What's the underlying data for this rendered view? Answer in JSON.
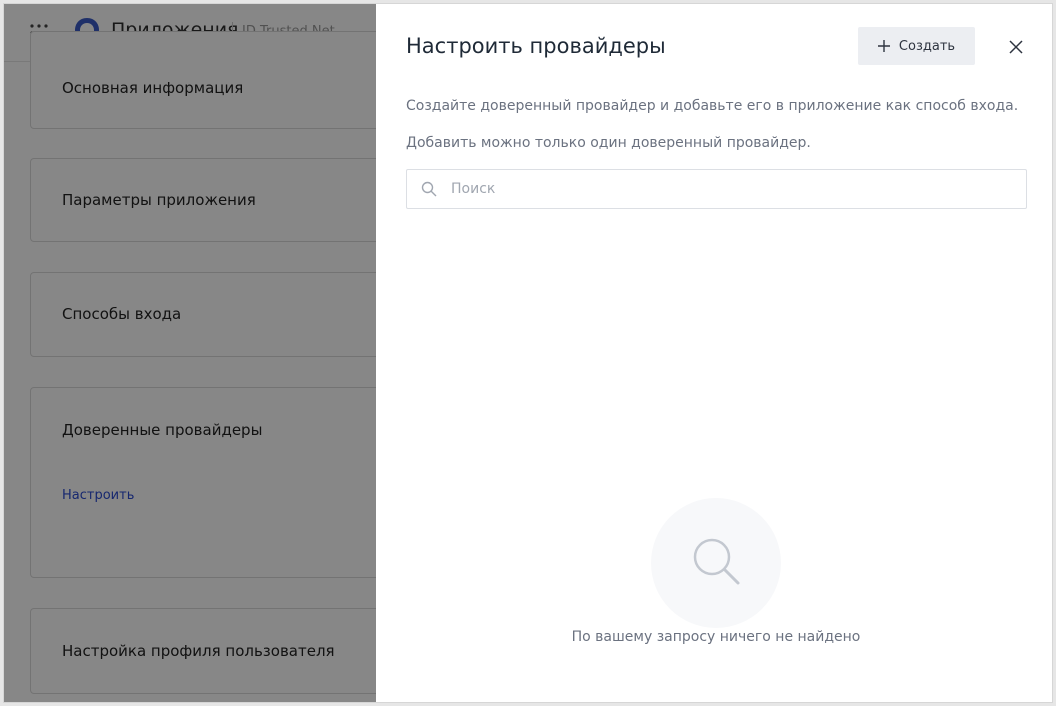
{
  "app": {
    "title": "Приложения",
    "subtitle": "ID.Trusted.Net",
    "cards": [
      {
        "title": "Основная информация"
      },
      {
        "title": "Параметры приложения"
      },
      {
        "title": "Способы входа"
      },
      {
        "title": "Доверенные провайдеры",
        "link": "Настроить"
      },
      {
        "title": "Настройка профиля пользователя"
      }
    ]
  },
  "drawer": {
    "title": "Настроить провайдеры",
    "create_label": "Создать",
    "description_1": "Создайте доверенный провайдер и добавьте его в приложение как способ входа.",
    "description_2": "Добавить можно только один доверенный провайдер.",
    "search": {
      "placeholder": "Поиск",
      "value": ""
    },
    "empty_text": "По вашему запросу ничего не найдено"
  },
  "icons": {
    "apps_grid": "grid-icon",
    "logo": "logo-icon",
    "create": "plus-icon",
    "close": "close-icon",
    "search": "search-icon",
    "empty_state": "magnifier-icon"
  },
  "colors": {
    "link": "#2b4bd1",
    "logo": "#3b5bc7",
    "overlay": "rgba(0,0,0,0.47)",
    "button_bg": "#eceef2"
  }
}
